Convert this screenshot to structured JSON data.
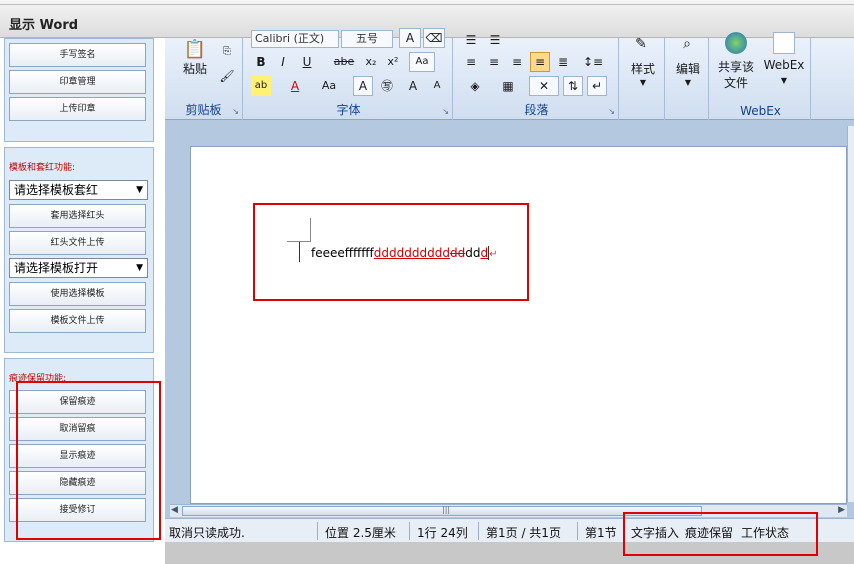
{
  "window": {
    "title": "显示 Word"
  },
  "left_panel": {
    "sign_buttons": [
      "手写签名",
      "印章管理",
      "上传印章"
    ],
    "template_section": {
      "heading": "模板和套红功能:",
      "select_redhead": "请选择模板套红",
      "buttons_a": [
        "套用选择红头",
        "红头文件上传"
      ],
      "select_template": "请选择模板打开",
      "buttons_b": [
        "使用选择模板",
        "模板文件上传"
      ]
    },
    "revision_section": {
      "heading": "痕迹保留功能:",
      "buttons": [
        "保留痕迹",
        "取消留痕",
        "显示痕迹",
        "隐藏痕迹",
        "接受修订"
      ]
    }
  },
  "ribbon": {
    "clipboard": {
      "label": "剪贴板",
      "paste": "粘贴"
    },
    "font": {
      "label": "字体",
      "font_name": "Calibri (正文)",
      "font_size": "五号",
      "buttons": [
        "B",
        "I",
        "U",
        "abe",
        "x₂",
        "x²",
        "Aa",
        "A",
        "A",
        "A",
        "A"
      ]
    },
    "paragraph": {
      "label": "段落"
    },
    "styles": {
      "label": "样式"
    },
    "editing": {
      "label": "编辑"
    },
    "webex": {
      "label": "WebEx",
      "share_line1": "共享该",
      "share_line2": "文件",
      "webex_btn": "WebEx"
    }
  },
  "document": {
    "text_plain": "feeeefffffff",
    "text_inserted": "dddddddddd",
    "text_deleted": "dd",
    "text_inserted2": "dd",
    "text_tail": "d"
  },
  "statusbar": {
    "message": "取消只读成功.",
    "position": "位置 2.5厘米",
    "line_col": "1行 24列",
    "page": "第1页 / 共1页",
    "section": "第1节",
    "insert_mode": "文字插入",
    "track_mode": "痕迹保留",
    "work_state": "工作状态"
  },
  "colors": {
    "accent_red": "#e00000",
    "ribbon_text": "#15428b"
  }
}
